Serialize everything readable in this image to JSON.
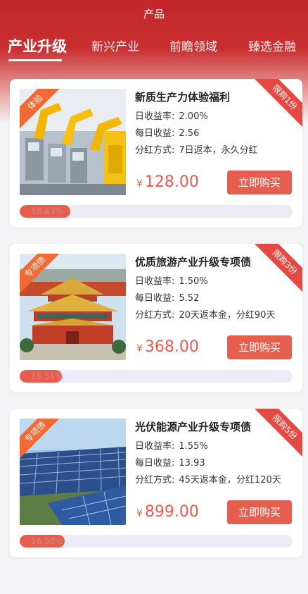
{
  "header": {
    "title": "产品",
    "tabs": [
      {
        "label": "产业升级",
        "active": true
      },
      {
        "label": "新兴产业",
        "active": false
      },
      {
        "label": "前瞻领域",
        "active": false
      },
      {
        "label": "臻选金融",
        "active": false
      }
    ]
  },
  "products": [
    {
      "tag": "体验",
      "limit": "限购1份",
      "name": "新质生产力体验福利",
      "rate_label": "日收益率:",
      "rate": "2.00%",
      "daily_label": "每日收益:",
      "daily": "2.56",
      "dividend_label": "分红方式:",
      "dividend": "7日返本，永久分红",
      "currency": "¥",
      "price": "128.00",
      "buy_label": "立即购买",
      "progress_text": "18.43%",
      "progress": 0.1843,
      "image": "robotic-arm-factory"
    },
    {
      "tag": "专项债",
      "limit": "限购3份",
      "name": "优质旅游产业升级专项债",
      "rate_label": "日收益率:",
      "rate": "1.50%",
      "daily_label": "每日收益:",
      "daily": "5.52",
      "dividend_label": "分红方式:",
      "dividend": "20天返本金，分红90天",
      "currency": "¥",
      "price": "368.00",
      "buy_label": "立即购买",
      "progress_text": "15.51%",
      "progress": 0.1551,
      "image": "forbidden-city"
    },
    {
      "tag": "专项债",
      "limit": "限购5份",
      "name": "光伏能源产业升级专项债",
      "rate_label": "日收益率:",
      "rate": "1.55%",
      "daily_label": "每日收益:",
      "daily": "13.93",
      "dividend_label": "分红方式:",
      "dividend": "45天返本金，分红120天",
      "currency": "¥",
      "price": "899.00",
      "buy_label": "立即购买",
      "progress_text": "16.50%",
      "progress": 0.165,
      "image": "solar-panels"
    }
  ]
}
